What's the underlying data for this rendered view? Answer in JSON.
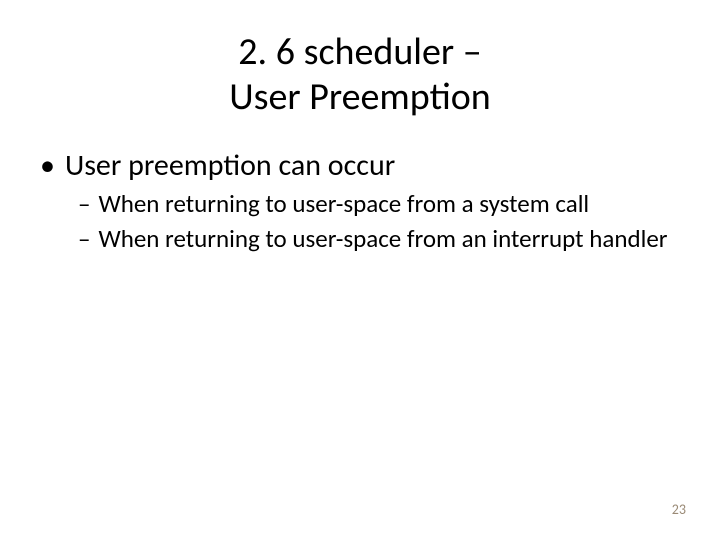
{
  "title_line1": "2. 6 scheduler –",
  "title_line2": "User Preemption",
  "bullet": {
    "marker": "•",
    "text": "User preemption can occur"
  },
  "sub1": {
    "marker": "–",
    "text": "When returning to user-space from a system call"
  },
  "sub2": {
    "marker": "–",
    "text": "When returning to user-space from an interrupt handler"
  },
  "page_number": "23"
}
